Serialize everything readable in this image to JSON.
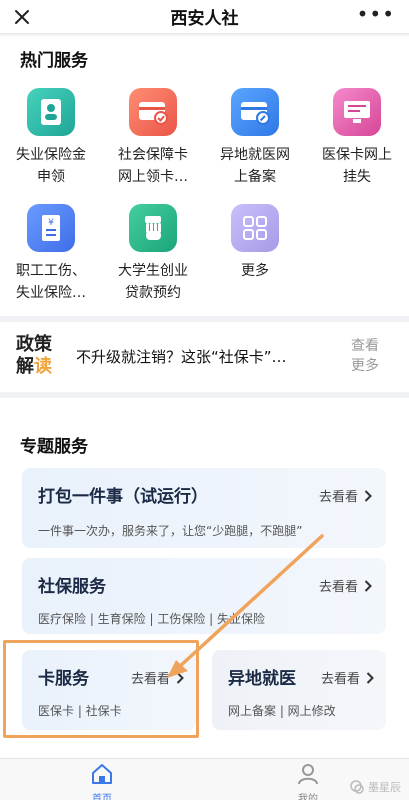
{
  "topbar": {
    "title": "西安人社",
    "close_icon": "close-icon",
    "more_label": "•••"
  },
  "hot": {
    "title": "热门服务",
    "items": [
      {
        "label": "失业保险金\n申领",
        "icon": "document-person-icon",
        "color": "#2bb8a6"
      },
      {
        "label": "社会保障卡\n网上领卡…",
        "icon": "card-check-icon",
        "color": "#f06b59"
      },
      {
        "label": "异地就医网\n上备案",
        "icon": "card-edit-icon",
        "color": "#3d8ef0"
      },
      {
        "label": "医保卡网上\n挂失",
        "icon": "monitor-icon",
        "color": "#e35da8"
      },
      {
        "label": "职工工伤、\n失业保险…",
        "icon": "yuan-document-icon",
        "color": "#4b7ff0"
      },
      {
        "label": "大学生创业\n贷款预约",
        "icon": "hand-icon",
        "color": "#27b58a"
      },
      {
        "label": "更多",
        "icon": "grid-icon",
        "color": "#b9aef5"
      }
    ]
  },
  "news": {
    "badge_line1": "政策",
    "badge_line2a": "解",
    "badge_line2b": "读",
    "headline": "不升级就注销？这张“社保卡”…",
    "more_line1": "查看",
    "more_line2": "更多"
  },
  "topic": {
    "title": "专题服务",
    "go_label": "去看看",
    "cards": [
      {
        "title": "打包一件事（试运行）",
        "sub": "一件事一次办，服务来了，让您“少跑腿，不跑腿”"
      },
      {
        "title": "社保服务",
        "sub": "医疗保险 | 生育保险 | 工伤保险 | 失业保险"
      },
      {
        "title": "卡服务",
        "sub": "医保卡 | 社保卡"
      },
      {
        "title": "异地就医",
        "sub": "网上备案 | 网上修改"
      }
    ]
  },
  "tabbar": {
    "home_label": "首页",
    "me_label": "我的",
    "watermark": "墨星辰",
    "accent": "#3a78e8"
  },
  "annotation_color": "#f0a35a"
}
